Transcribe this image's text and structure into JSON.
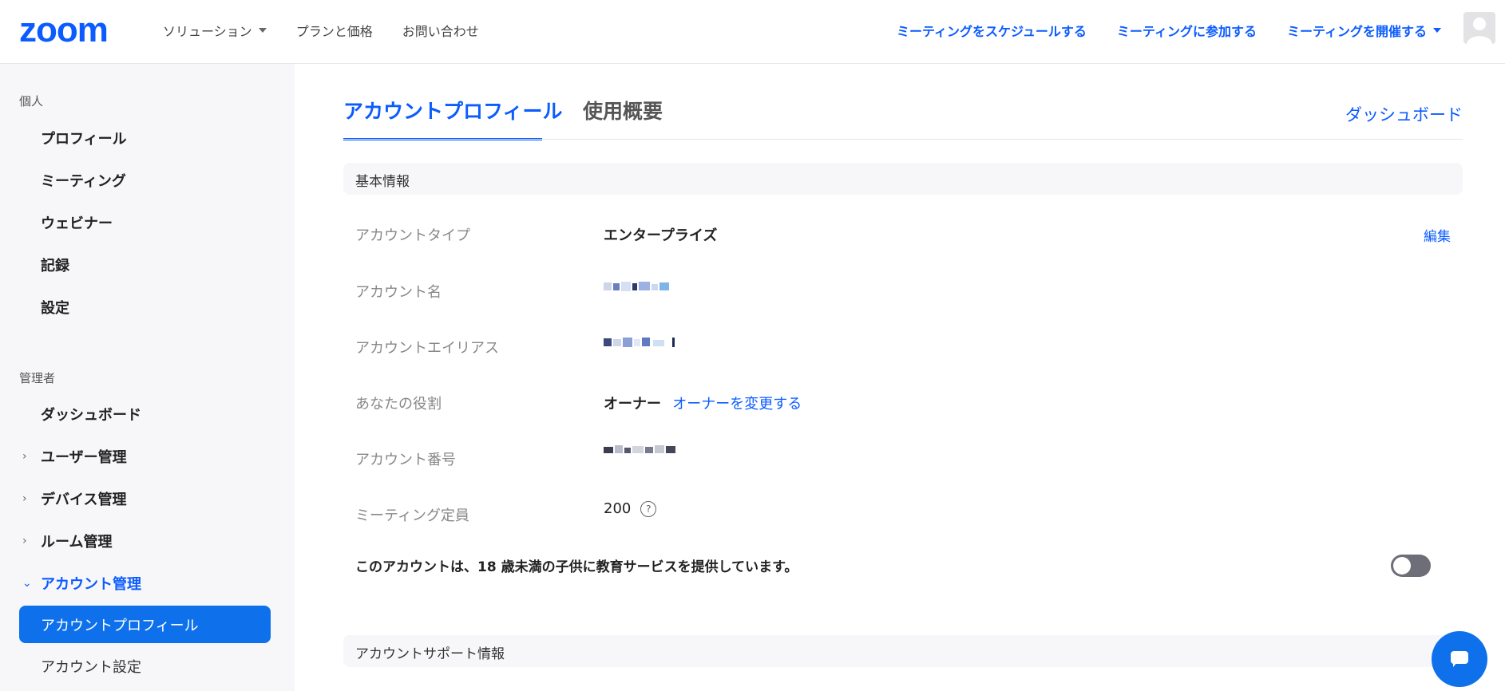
{
  "brand": {
    "logo_text": "zoom",
    "accent": "#0b5cff"
  },
  "topnav": {
    "left": [
      {
        "label": "ソリューション"
      },
      {
        "label": "プランと価格"
      },
      {
        "label": "お問い合わせ"
      }
    ],
    "right": [
      {
        "label": "ミーティングをスケジュールする"
      },
      {
        "label": "ミーティングに参加する"
      },
      {
        "label": "ミーティングを開催する"
      }
    ]
  },
  "sidebar": {
    "personal_label": "個人",
    "personal_items": [
      "プロフィール",
      "ミーティング",
      "ウェビナー",
      "記録",
      "設定"
    ],
    "admin_label": "管理者",
    "admin_items": {
      "dashboard": "ダッシュボード",
      "user_mgmt": "ユーザー管理",
      "device_mgmt": "デバイス管理",
      "room_mgmt": "ルーム管理",
      "account_mgmt": "アカウント管理"
    },
    "sub_active": "アカウントプロフィール",
    "sub_next": "アカウント設定"
  },
  "main": {
    "tabs": [
      "アカウントプロフィール",
      "使用概要"
    ],
    "dashboard_link": "ダッシュボード",
    "section_basic": "基本情報",
    "rows": {
      "account_type_label": "アカウントタイプ",
      "account_type_value": "エンタープライズ",
      "edit": "編集",
      "account_name_label": "アカウント名",
      "account_alias_label": "アカウントエイリアス",
      "role_label": "あなたの役割",
      "role_value": "オーナー",
      "role_change": "オーナーを変更する",
      "account_number_label": "アカウント番号",
      "capacity_label": "ミーティング定員",
      "capacity_value": "200"
    },
    "notice": "このアカウントは、18 歳未満の子供に教育サービスを提供しています。",
    "toggle_on": false,
    "section_support": "アカウントサポート情報"
  }
}
